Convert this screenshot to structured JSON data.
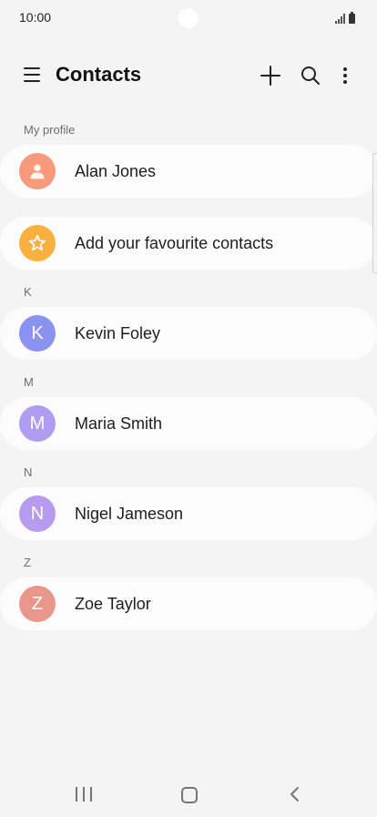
{
  "status_bar": {
    "time": "10:00"
  },
  "app_bar": {
    "title": "Contacts"
  },
  "sections": {
    "my_profile": "My profile",
    "k": "K",
    "m": "M",
    "n": "N",
    "z": "Z"
  },
  "profile": {
    "name": "Alan Jones",
    "color": "#f79a7c"
  },
  "favourites": {
    "label": "Add your favourite contacts",
    "color": "#f8b13e"
  },
  "contacts": [
    {
      "initial": "K",
      "name": "Kevin Foley",
      "color": "#8a93ef"
    },
    {
      "initial": "M",
      "name": "Maria Smith",
      "color": "#b09cf0"
    },
    {
      "initial": "N",
      "name": "Nigel Jameson",
      "color": "#b79bee"
    },
    {
      "initial": "Z",
      "name": "Zoe Taylor",
      "color": "#e8978a"
    }
  ]
}
